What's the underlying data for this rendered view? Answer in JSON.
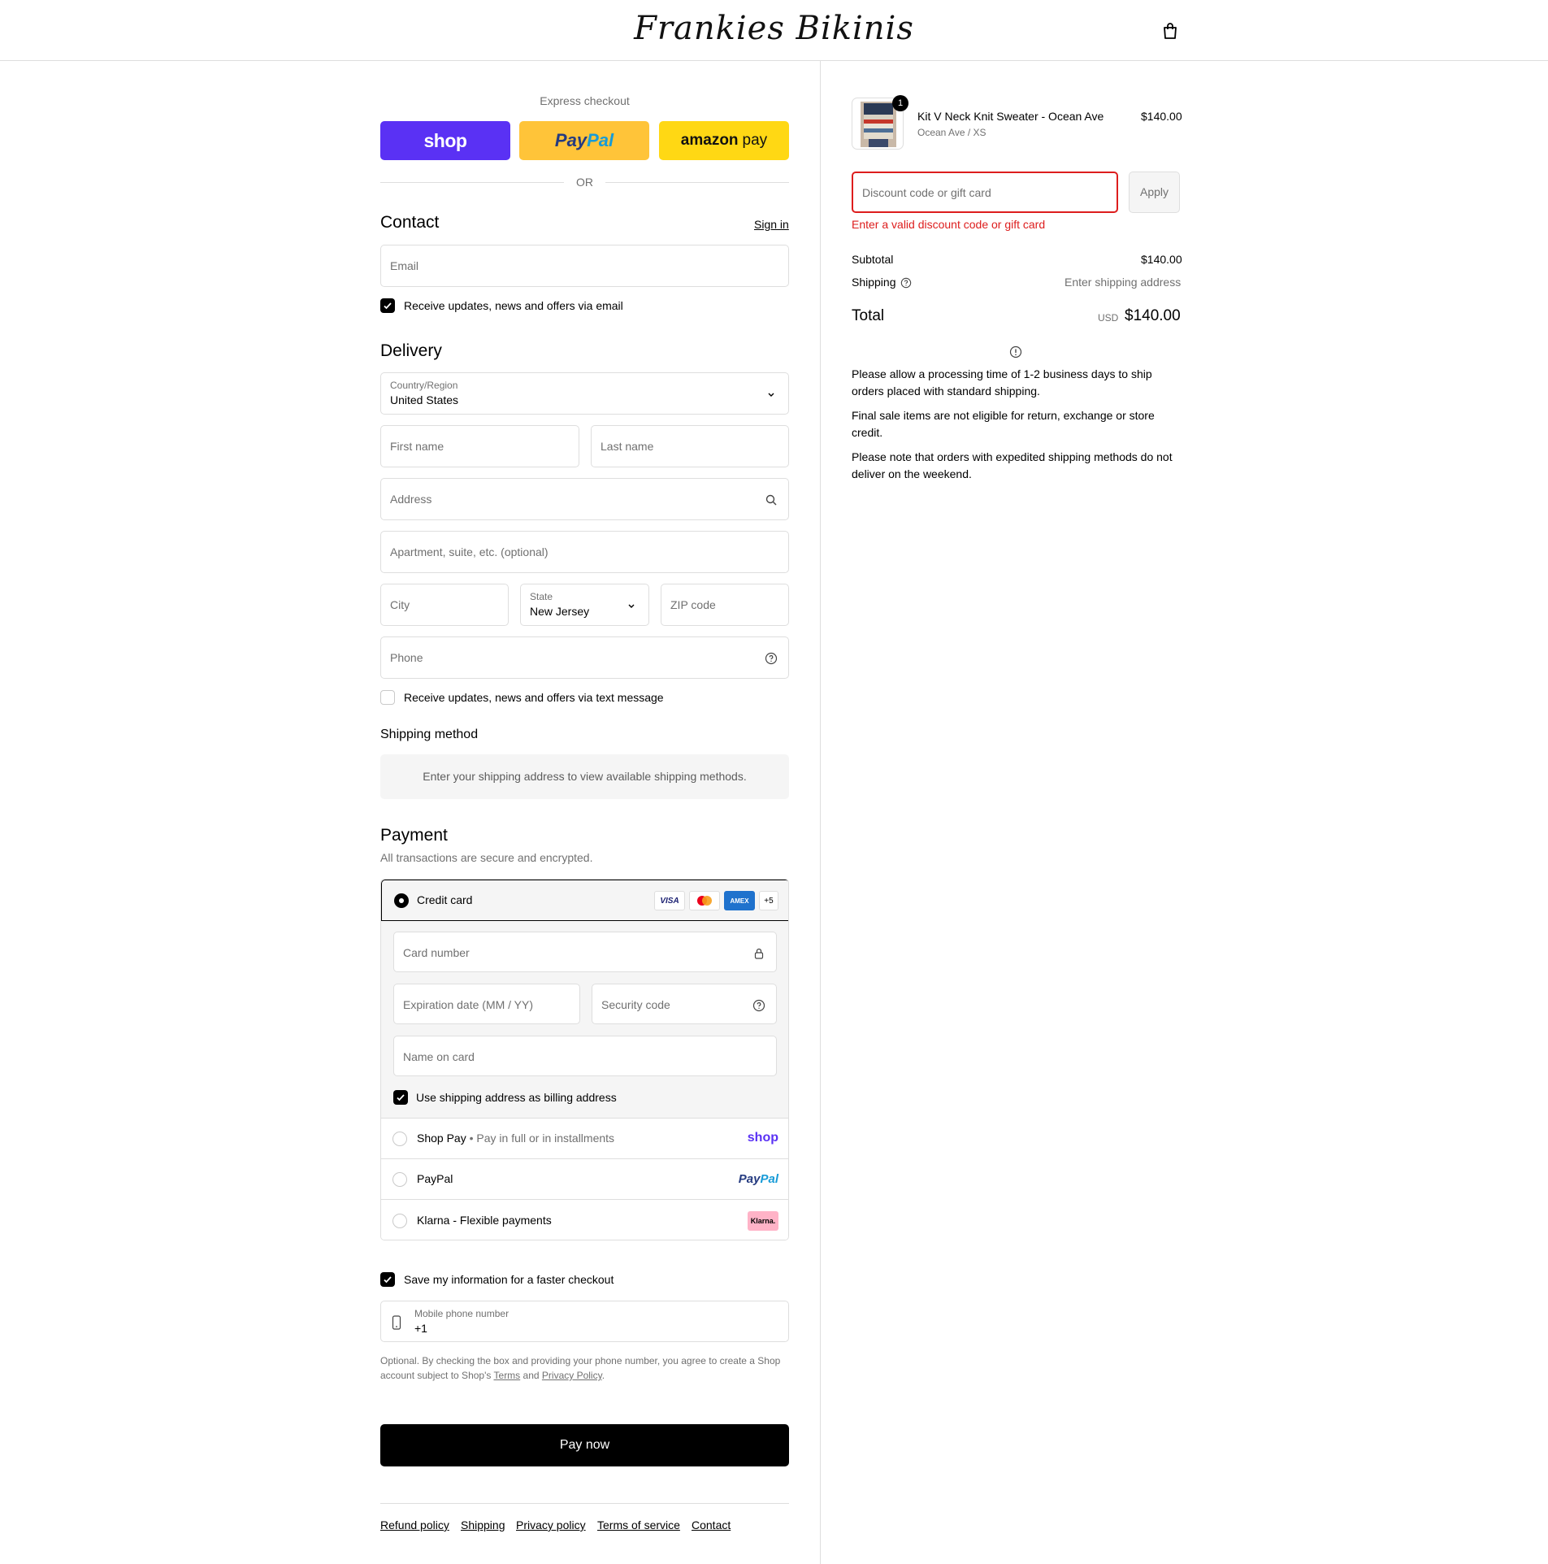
{
  "header": {
    "brand": "Frankies Bikinis"
  },
  "express": {
    "title": "Express checkout",
    "shop_label": "shop",
    "paypal_label_a": "Pay",
    "paypal_label_b": "Pal",
    "amazon_label_a": "amazon",
    "amazon_label_b": "pay",
    "or_label": "OR"
  },
  "contact": {
    "heading": "Contact",
    "sign_in": "Sign in",
    "email_placeholder": "Email",
    "newsletter_label": "Receive updates, news and offers via email"
  },
  "delivery": {
    "heading": "Delivery",
    "country_label": "Country/Region",
    "country_value": "United States",
    "first_name": "First name",
    "last_name": "Last name",
    "address": "Address",
    "apartment": "Apartment, suite, etc. (optional)",
    "city": "City",
    "state_label": "State",
    "state_value": "New Jersey",
    "zip": "ZIP code",
    "phone": "Phone",
    "sms_label": "Receive updates, news and offers via text message"
  },
  "shipping_method": {
    "heading": "Shipping method",
    "message": "Enter your shipping address to view available shipping methods."
  },
  "payment": {
    "heading": "Payment",
    "subtitle": "All transactions are secure and encrypted.",
    "credit_card_label": "Credit card",
    "card_badges": [
      "VISA",
      "AMEX",
      "+5"
    ],
    "card_number": "Card number",
    "expiration": "Expiration date (MM / YY)",
    "security_code": "Security code",
    "name_on_card": "Name on card",
    "billing_same_label": "Use shipping address as billing address",
    "shop_pay_label": "Shop Pay",
    "shop_pay_sub": "Pay in full or in installments",
    "shop_pay_logo": "shop",
    "paypal_label": "PayPal",
    "paypal_logo_a": "Pay",
    "paypal_logo_b": "Pal",
    "klarna_label": "Klarna - Flexible payments",
    "klarna_logo": "Klarna."
  },
  "remember": {
    "save_label": "Save my information for a faster checkout",
    "mobile_label": "Mobile phone number",
    "mobile_value": "+1",
    "fine_a": "Optional. By checking the box and providing your phone number, you agree to create a Shop account subject to Shop's",
    "terms": "Terms",
    "and": "and",
    "privacy": "Privacy Policy"
  },
  "pay_now": "Pay now",
  "footer": [
    "Refund policy",
    "Shipping",
    "Privacy policy",
    "Terms of service",
    "Contact"
  ],
  "order": {
    "qty": "1",
    "item_name": "Kit V Neck Knit Sweater - Ocean Ave",
    "item_variant": "Ocean Ave / XS",
    "item_price": "$140.00",
    "discount_placeholder": "Discount code or gift card",
    "apply": "Apply",
    "discount_error": "Enter a valid discount code or gift card",
    "subtotal_label": "Subtotal",
    "subtotal_value": "$140.00",
    "shipping_label": "Shipping",
    "shipping_value": "Enter shipping address",
    "total_label": "Total",
    "currency": "USD",
    "total_value": "$140.00",
    "notes": [
      "Please allow a processing time of 1-2 business days to ship orders placed with standard shipping.",
      "Final sale items are not eligible for return, exchange or store credit.",
      "Please note that orders with expedited shipping methods do not deliver on the weekend."
    ]
  },
  "colors": {
    "shop_purple": "#5a31f4",
    "paypal_yellow": "#ffc439",
    "amazon_yellow": "#ffd814",
    "error_red": "#dd1d1d"
  }
}
